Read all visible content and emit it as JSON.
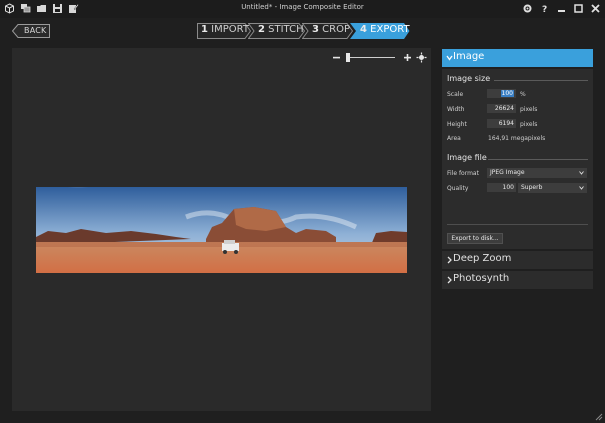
{
  "window": {
    "title": "Untitled* - Image Composite Editor",
    "toolbar_icons": [
      "new-project-icon",
      "new-panorama-icon",
      "open-folder-icon",
      "save-icon",
      "save-as-icon",
      "settings-icon",
      "help-icon"
    ],
    "controls": [
      "minimize-icon",
      "maximize-icon",
      "close-icon"
    ]
  },
  "nav": {
    "back_label": "BACK",
    "steps": [
      {
        "num": "1",
        "label": "IMPORT",
        "active": false
      },
      {
        "num": "2",
        "label": "STITCH",
        "active": false
      },
      {
        "num": "3",
        "label": "CROP",
        "active": false
      },
      {
        "num": "4",
        "label": "EXPORT",
        "active": true
      }
    ]
  },
  "zoom": {
    "minus": "−",
    "plus": "+",
    "level": 0.05
  },
  "panel": {
    "image_section": {
      "title": "Image",
      "image_size_header": "Image size",
      "scale_label": "Scale",
      "scale_value": "100",
      "scale_unit": "%",
      "width_label": "Width",
      "width_value": "26624",
      "width_unit": "pixels",
      "height_label": "Height",
      "height_value": "6194",
      "height_unit": "pixels",
      "area_label": "Area",
      "area_value": "164,91 megapixels",
      "image_file_header": "Image file",
      "format_label": "File format",
      "format_value": "JPEG Image",
      "quality_label": "Quality",
      "quality_value": "100",
      "quality_preset": "Superb",
      "export_button": "Export to disk..."
    },
    "deep_zoom_title": "Deep Zoom",
    "photosynth_title": "Photosynth"
  },
  "colors": {
    "accent": "#3aa0dc",
    "canvas": "#2a2a2a",
    "panel": "#2c2c2c",
    "background": "#1f1f1f"
  }
}
